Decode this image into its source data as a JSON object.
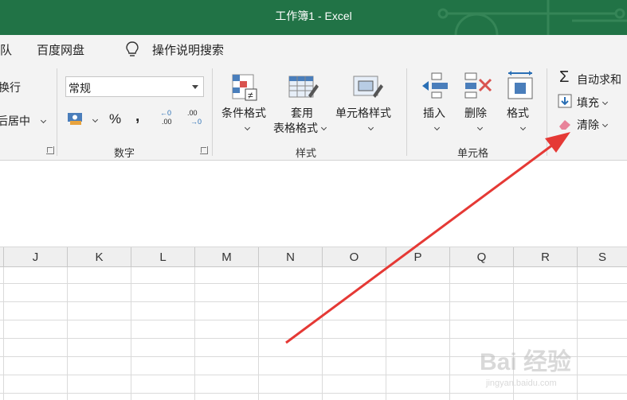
{
  "window": {
    "title": "工作簿1  -  Excel"
  },
  "tabs": [
    {
      "label": "队"
    },
    {
      "label": "百度网盘"
    },
    {
      "label": "操作说明搜索"
    }
  ],
  "alignment": {
    "wrap_label": "换行",
    "merge_label": "后居中"
  },
  "number": {
    "format_value": "常规",
    "percent_symbol": "%",
    "comma_symbol": ",",
    "increase_decimal": ".00",
    "decrease_decimal": ".00",
    "group_label": "数字"
  },
  "styles": {
    "conditional_label": "条件格式",
    "table_label_1": "套用",
    "table_label_2": "表格格式",
    "cell_styles_label": "单元格样式",
    "group_label": "样式"
  },
  "cells": {
    "insert_label": "插入",
    "delete_label": "删除",
    "format_label": "格式",
    "group_label": "单元格"
  },
  "editing": {
    "autosum_label": "自动求和",
    "fill_label": "填充",
    "clear_label": "清除"
  },
  "columns": [
    "J",
    "K",
    "L",
    "M",
    "N",
    "O",
    "P",
    "Q",
    "R",
    "S"
  ],
  "colors": {
    "brand": "#217346",
    "annotation_arrow": "#e53935"
  },
  "watermark": {
    "line1": "Bai 经验",
    "line2": "jingyan.baidu.com"
  }
}
